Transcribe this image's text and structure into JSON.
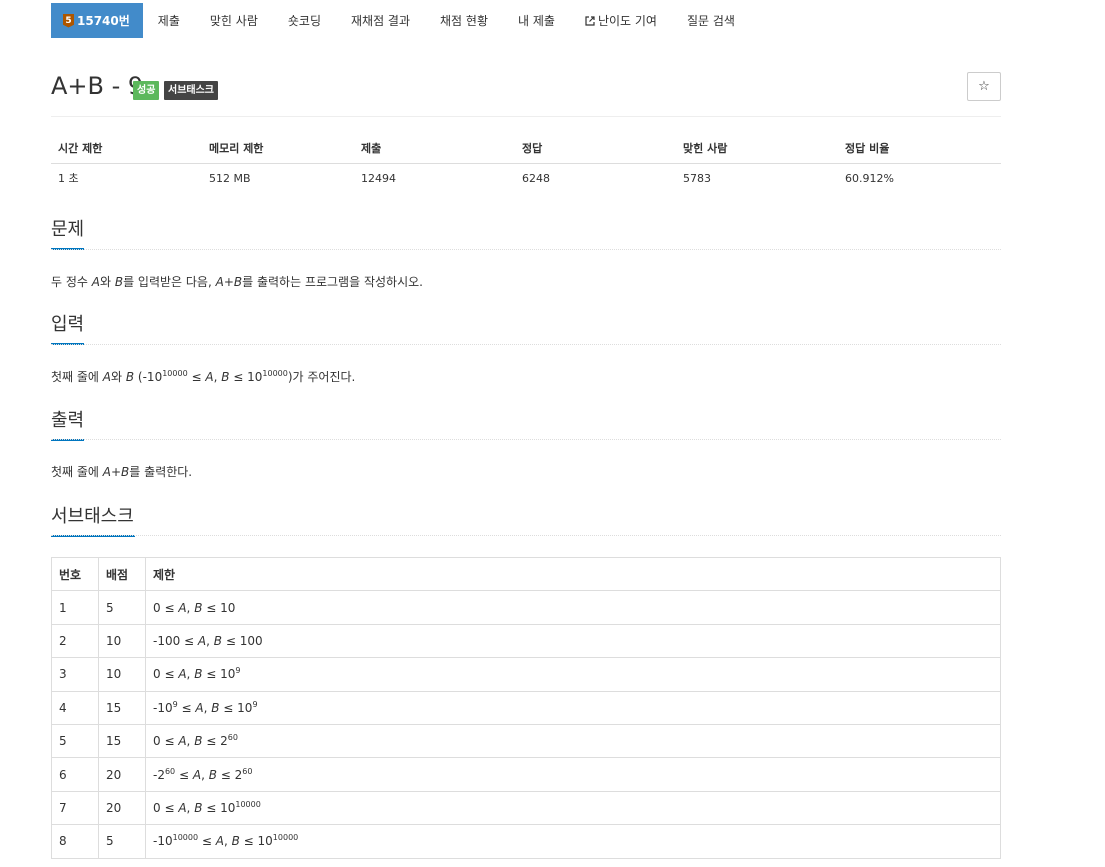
{
  "nav": {
    "problem_number": "15740번",
    "tier_badge": "5",
    "items": [
      "제출",
      "맞힌 사람",
      "숏코딩",
      "재채점 결과",
      "채점 현황",
      "내 제출",
      "난이도 기여",
      "질문 검색"
    ]
  },
  "problem": {
    "title": "A+B - 9",
    "label_success": "성공",
    "label_subtask": "서브태스크",
    "star": "☆"
  },
  "info": {
    "headers": [
      "시간 제한",
      "메모리 제한",
      "제출",
      "정답",
      "맞힌 사람",
      "정답 비율"
    ],
    "values": [
      "1 초",
      "512 MB",
      "12494",
      "6248",
      "5783",
      "60.912%"
    ]
  },
  "sections": {
    "problem_title": "문제",
    "problem_text": "두 정수 A와 B를 입력받은 다음, A+B를 출력하는 프로그램을 작성하시오.",
    "input_title": "입력",
    "input_text": "첫째 줄에 A와 B (-10^10000 ≤ A, B ≤ 10^10000)가 주어진다.",
    "output_title": "출력",
    "output_text": "첫째 줄에 A+B를 출력한다.",
    "subtask_title": "서브태스크"
  },
  "subtasks": {
    "headers": [
      "번호",
      "배점",
      "제한"
    ],
    "rows": [
      {
        "num": "1",
        "score": "5",
        "limit": "0 ≤ A, B ≤ 10"
      },
      {
        "num": "2",
        "score": "10",
        "limit": "-100 ≤ A, B ≤ 100"
      },
      {
        "num": "3",
        "score": "10",
        "limit": "0 ≤ A, B ≤ 10^9"
      },
      {
        "num": "4",
        "score": "15",
        "limit": "-10^9 ≤ A, B ≤ 10^9"
      },
      {
        "num": "5",
        "score": "15",
        "limit": "0 ≤ A, B ≤ 2^60"
      },
      {
        "num": "6",
        "score": "20",
        "limit": "-2^60 ≤ A, B ≤ 2^60"
      },
      {
        "num": "7",
        "score": "20",
        "limit": "0 ≤ A, B ≤ 10^10000"
      },
      {
        "num": "8",
        "score": "5",
        "limit": "-10^10000 ≤ A, B ≤ 10^10000"
      }
    ]
  },
  "colors": {
    "nav_active": "#428bca",
    "label_success": "#5cb85c",
    "label_subtask": "#444444",
    "tier_bronze": "#ad5600",
    "section_underline": "#0076c0"
  }
}
